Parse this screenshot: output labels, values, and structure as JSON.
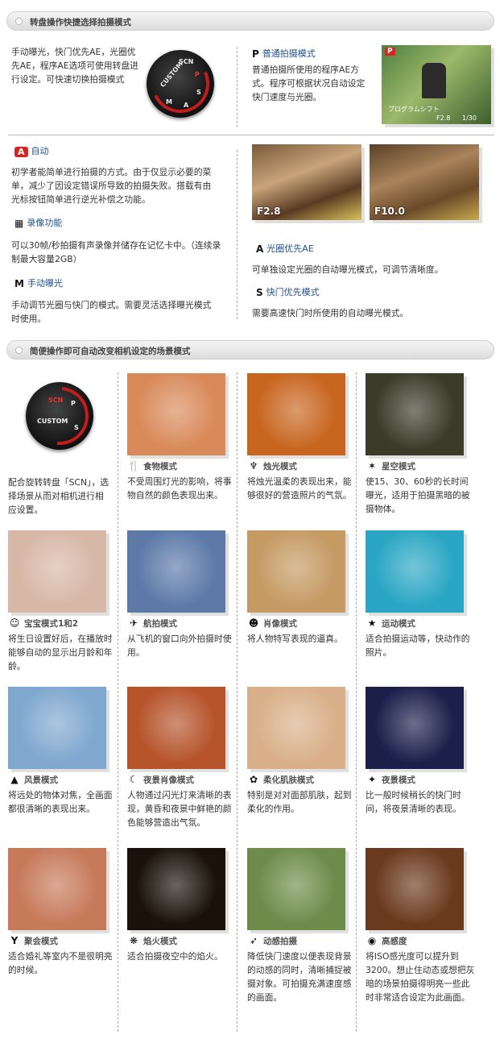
{
  "section1": {
    "title": "转盘操作快捷选择拍摄模式"
  },
  "section2": {
    "title": "简便操作即可自动改变相机设定的场景模式"
  },
  "dial_intro": "手动曝光，快门优先AE，光圈优先AE，程序AE选项可使用转盘进行设定。可快速切换拍摄模式",
  "dial_labels": {
    "custom": "CUSTOM",
    "scn": "SCN",
    "s": "S",
    "a": "A",
    "m": "M",
    "p": "P"
  },
  "program": {
    "badge": "P",
    "title": "普通拍摄模式",
    "desc": "普通拍摄所使用的程序AE方式。程序可根据状况自动设定快门速度与光圈。"
  },
  "program_screen": {
    "mode": "P",
    "mode_name": "プログラムシフト",
    "aperture": "F2.8",
    "shutter": "1/30"
  },
  "auto": {
    "badge": "A",
    "title": "自动",
    "desc": "初学者能简单进行拍摄的方式。由于仅显示必要的菜单，减少了因设定错误所导致的拍摄失败。搭载有由光标按钮简单进行逆光补偿之功能。"
  },
  "movie": {
    "icon": "film-icon",
    "title": "录像功能",
    "desc": "可以30帧/秒拍摄有声录像并储存在记忆卡中。（连续录制最大容量2GB）"
  },
  "manual": {
    "badge": "M",
    "title": "手动曝光",
    "desc": "手动调节光圈与快门的模式。需要灵活选择曝光模式时使用。"
  },
  "aperture_tags": {
    "left": "F2.8",
    "right": "F10.0"
  },
  "aperture": {
    "badge": "A",
    "title": "光圈优先AE",
    "desc": "可单独设定光圈的自动曝光模式，可调节清晰度。"
  },
  "shutter": {
    "badge": "S",
    "title": "快门优先模式",
    "desc": "需要高速快门时所使用的自动曝光模式。"
  },
  "scn_intro": "配合旋转转盘「SCN」，选择场景从而对相机进行相应设置。",
  "scenes": [
    {
      "title": "食物模式",
      "icon": "food-icon",
      "glyph": "🍴",
      "desc": "不受周围灯光的影响，将事物自然的颜色表现出来。",
      "color": "#d98a5a"
    },
    {
      "title": "烛光模式",
      "icon": "candle-icon",
      "glyph": "♆",
      "desc": "将烛光温柔的表现出来，能够很好的营造照片的气氛。",
      "color": "#c8651f"
    },
    {
      "title": "星空模式",
      "icon": "star-icon",
      "glyph": "✶",
      "desc": "使15、30、60秒的长时间曝光，适用于拍摄黑暗的被摄物体。",
      "color": "#3b3b2a"
    },
    {
      "title": "宝宝模式1和2",
      "icon": "baby-icon",
      "glyph": "☺",
      "desc": "将生日设置好后，在播放时能够自动的显示出月龄和年龄。",
      "color": "#d7b7a6"
    },
    {
      "title": "航拍模式",
      "icon": "airplane-icon",
      "glyph": "✈",
      "desc": "从飞机的窗口向外拍摄时使用。",
      "color": "#5c79a8"
    },
    {
      "title": "肖像模式",
      "icon": "portrait-icon",
      "glyph": "☻",
      "desc": "将人物特写表现的逼真。",
      "color": "#c59a63"
    },
    {
      "title": "运动模式",
      "icon": "sports-icon",
      "glyph": "★",
      "desc": "适合拍摄运动等，快动作的照片。",
      "color": "#2aa6c4"
    },
    {
      "title": "风景模式",
      "icon": "landscape-icon",
      "glyph": "▲",
      "desc": "将远处的物体对焦，全画面都很清晰的表现出来。",
      "color": "#7fa7cf"
    },
    {
      "title": "夜景肖像模式",
      "icon": "night-portrait-icon",
      "glyph": "☾",
      "desc": "人物通过闪光灯来清晰的表现，黄昏和夜景中鲜艳的颜色能够营造出气氛。",
      "color": "#b5532a"
    },
    {
      "title": "柔化肌肤模式",
      "icon": "soft-skin-icon",
      "glyph": "✿",
      "desc": "特别是对对面部肌肤，起到柔化的作用。",
      "color": "#d9b08a"
    },
    {
      "title": "夜景模式",
      "icon": "night-icon",
      "glyph": "✦",
      "desc": "比一般时候稍长的快门时间，将夜景清晰的表现。",
      "color": "#1b1f4a"
    },
    {
      "title": "聚会模式",
      "icon": "party-icon",
      "glyph": "Y",
      "desc": "适合婚礼等室内不是很明亮的时候。",
      "color": "#c77a5a"
    },
    {
      "title": "焰火模式",
      "icon": "fireworks-icon",
      "glyph": "❋",
      "desc": "适合拍摄夜空中的焰火。",
      "color": "#1a120a"
    },
    {
      "title": "动感拍摄",
      "icon": "panning-icon",
      "glyph": "➶",
      "desc": "降低快门速度以便表现背景的动感的同时，清晰捕捉被摄对象。可拍摄充满速度感的画面。",
      "color": "#6e8b4a"
    },
    {
      "title": "高感度",
      "icon": "high-sensitivity-icon",
      "glyph": "◉",
      "desc": "将ISO感光度可以提升到3200。想止住动态或想把灰暗的场景拍摄得明亮一些此时非常适合设定为此画面。",
      "color": "#6b3a1e"
    }
  ]
}
